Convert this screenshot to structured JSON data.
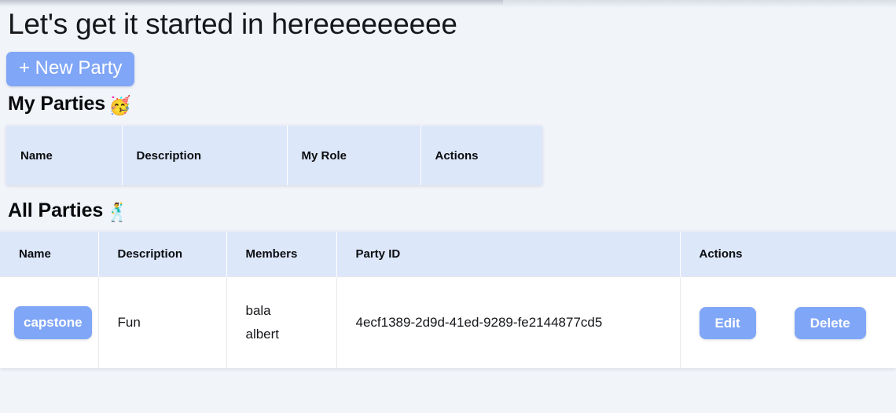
{
  "theme": {
    "page_background": "#f1f4f9",
    "accent_blue": "#80a6f7",
    "table_header_blue": "#dde7fa",
    "card_white": "#ffffff",
    "text_dark": "#14161a"
  },
  "header": {
    "title": "Let's get it started in hereeeeeeeee"
  },
  "toolbar": {
    "new_party_label": "+ New Party"
  },
  "my_parties": {
    "heading": "My Parties",
    "emoji": "🥳",
    "emoji_name": "partying-face-emoji",
    "columns": [
      "Name",
      "Description",
      "My Role",
      "Actions"
    ],
    "rows": []
  },
  "all_parties": {
    "heading": "All Parties",
    "emoji": "🕺",
    "emoji_name": "man-dancing-emoji",
    "columns": [
      "Name",
      "Description",
      "Members",
      "Party ID",
      "Actions"
    ],
    "rows": [
      {
        "name": "capstone",
        "description": "Fun",
        "members": [
          "bala",
          "albert"
        ],
        "party_id": "4ecf1389-2d9d-41ed-9289-fe2144877cd5",
        "actions": {
          "edit_label": "Edit",
          "delete_label": "Delete"
        }
      }
    ]
  }
}
